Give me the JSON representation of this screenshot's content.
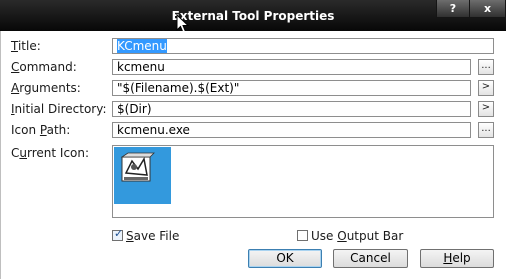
{
  "window": {
    "title": "External Tool Properties",
    "help_label": "?",
    "close_label": "x"
  },
  "fields": {
    "title_label": "Title:",
    "title_value": "KCmenu",
    "command_label": "Command:",
    "command_value": "kcmenu",
    "arguments_label": "Arguments:",
    "arguments_value": "\"$(Filename).$(Ext)\"",
    "initial_dir_label": "Initial Directory:",
    "initial_dir_value": "$(Dir)",
    "icon_path_label": "Icon Path:",
    "icon_path_value": "kcmenu.exe",
    "current_icon_label": "Current Icon:"
  },
  "mini_buttons": {
    "browse": "...",
    "arrow": ">"
  },
  "options": {
    "save_file_label": "Save File",
    "save_file_checked": true,
    "use_output_bar_label": "Use Output Bar",
    "use_output_bar_checked": false
  },
  "buttons": {
    "ok": "OK",
    "cancel": "Cancel",
    "help": "Help"
  },
  "colors": {
    "titlebar": "#0b0b0b",
    "selection": "#3399ff",
    "icon_tile": "#3399dd"
  }
}
